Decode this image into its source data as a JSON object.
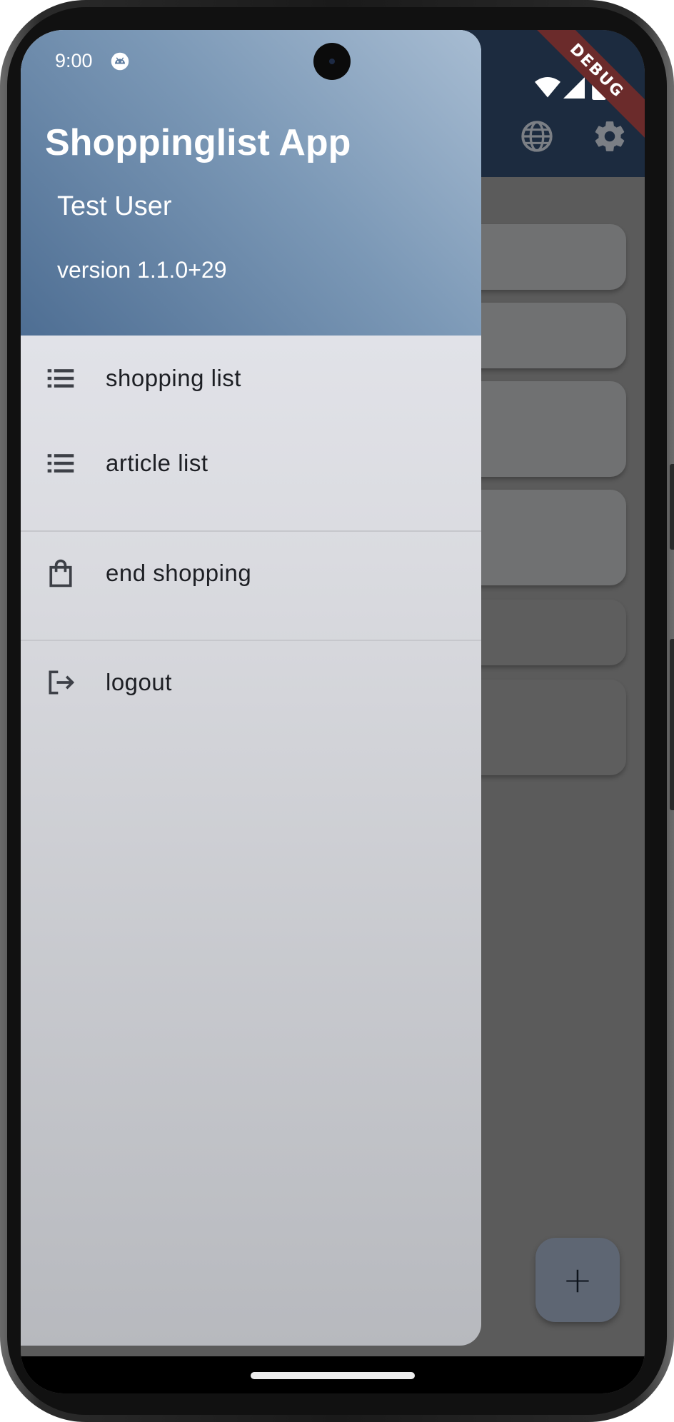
{
  "status_bar": {
    "time": "9:00",
    "app_icon": "android-robot-icon",
    "right_icons": [
      "wifi-icon",
      "signal-icon",
      "battery-icon"
    ]
  },
  "debug_banner": "DEBUG",
  "app_bar": {
    "actions": [
      "globe-icon",
      "settings-gear-icon"
    ]
  },
  "drawer": {
    "header": {
      "title": "Shoppinglist App",
      "user": "Test User",
      "version": "version 1.1.0+29"
    },
    "items": [
      {
        "label": "shopping list",
        "icon": "list-icon"
      },
      {
        "label": "article list",
        "icon": "list-icon"
      },
      {
        "label": "end shopping",
        "icon": "shopping-bag-icon"
      },
      {
        "label": "logout",
        "icon": "logout-icon"
      }
    ]
  },
  "fab": {
    "label": "+"
  },
  "colors": {
    "app_bar": "#1c2b3f",
    "drawer_header_start": "#a7bcd2",
    "drawer_header_end": "#4e6e93",
    "scrim": "#5b5b5b"
  }
}
